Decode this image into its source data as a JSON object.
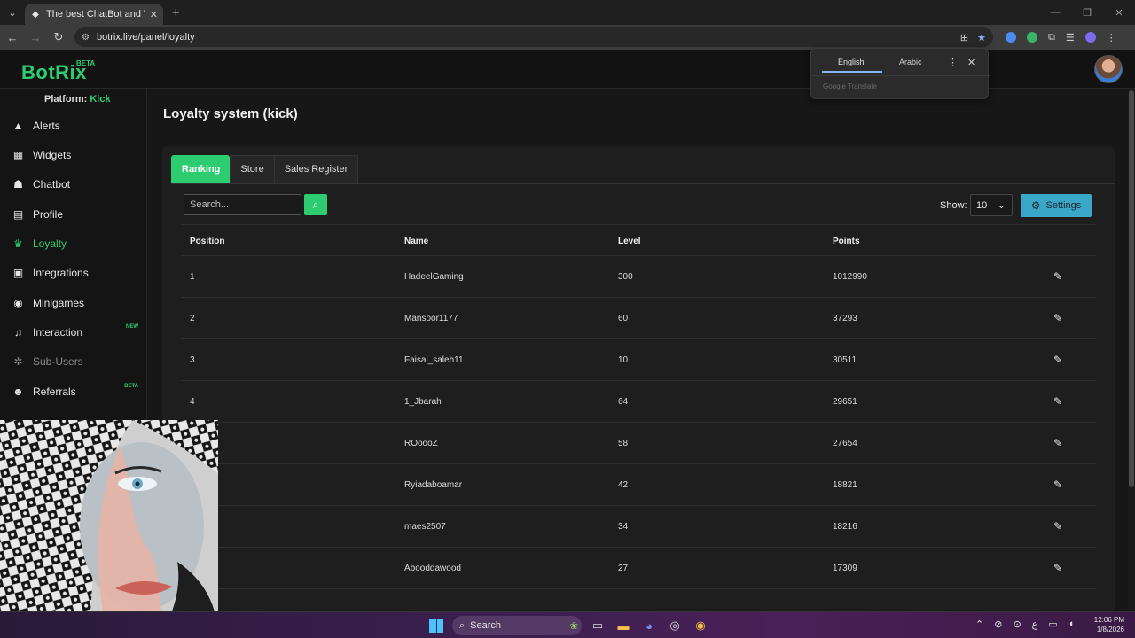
{
  "browser": {
    "tab_title": "The best ChatBot and Widgets",
    "url": "botrix.live/panel/loyalty"
  },
  "site": {
    "logo": "BotRix",
    "logo_badge": "BETA",
    "platform_label": "Platform:",
    "platform_value": "Kick",
    "brand_color": "#2ecc71"
  },
  "sidebar": {
    "items": [
      {
        "label": "Alerts",
        "icon": "warning-icon"
      },
      {
        "label": "Widgets",
        "icon": "grid-icon"
      },
      {
        "label": "Chatbot",
        "icon": "robot-icon"
      },
      {
        "label": "Profile",
        "icon": "id-card-icon"
      },
      {
        "label": "Loyalty",
        "icon": "trophy-icon",
        "active": true
      },
      {
        "label": "Integrations",
        "icon": "plug-icon"
      },
      {
        "label": "Minigames",
        "icon": "gamepad-icon"
      },
      {
        "label": "Interaction",
        "icon": "music-icon",
        "badge": "NEW"
      },
      {
        "label": "Sub-Users",
        "icon": "users-cog-icon",
        "disabled": true
      },
      {
        "label": "Referrals",
        "icon": "users-icon",
        "badge": "BETA"
      }
    ]
  },
  "main": {
    "page_title": "Loyalty system (kick)",
    "tabs": [
      "Ranking",
      "Store",
      "Sales Register"
    ],
    "search_placeholder": "Search...",
    "show_label": "Show:",
    "show_value": "10",
    "settings_label": "Settings",
    "table": {
      "columns": [
        "Position",
        "Name",
        "Level",
        "Points"
      ],
      "rows": [
        {
          "position": "1",
          "name": "HadeelGaming",
          "level": "300",
          "points": "1012990"
        },
        {
          "position": "2",
          "name": "Mansoor1177",
          "level": "60",
          "points": "37293"
        },
        {
          "position": "3",
          "name": "Faisal_saleh11",
          "level": "10",
          "points": "30511"
        },
        {
          "position": "4",
          "name": "1_Jbarah",
          "level": "64",
          "points": "29651"
        },
        {
          "position": "",
          "name": "ROoooZ",
          "level": "58",
          "points": "27654"
        },
        {
          "position": "",
          "name": "Ryiadaboamar",
          "level": "42",
          "points": "18821"
        },
        {
          "position": "",
          "name": "maes2507",
          "level": "34",
          "points": "18216"
        },
        {
          "position": "",
          "name": "Abooddawood",
          "level": "27",
          "points": "17309"
        }
      ]
    }
  },
  "translate_popup": {
    "lang_active": "English",
    "lang_other": "Arabic",
    "footer": "Google Translate"
  },
  "taskbar": {
    "search_label": "Search",
    "time": "12:06 PM",
    "date": "1/8/2026",
    "lang_indicator": "ع"
  }
}
